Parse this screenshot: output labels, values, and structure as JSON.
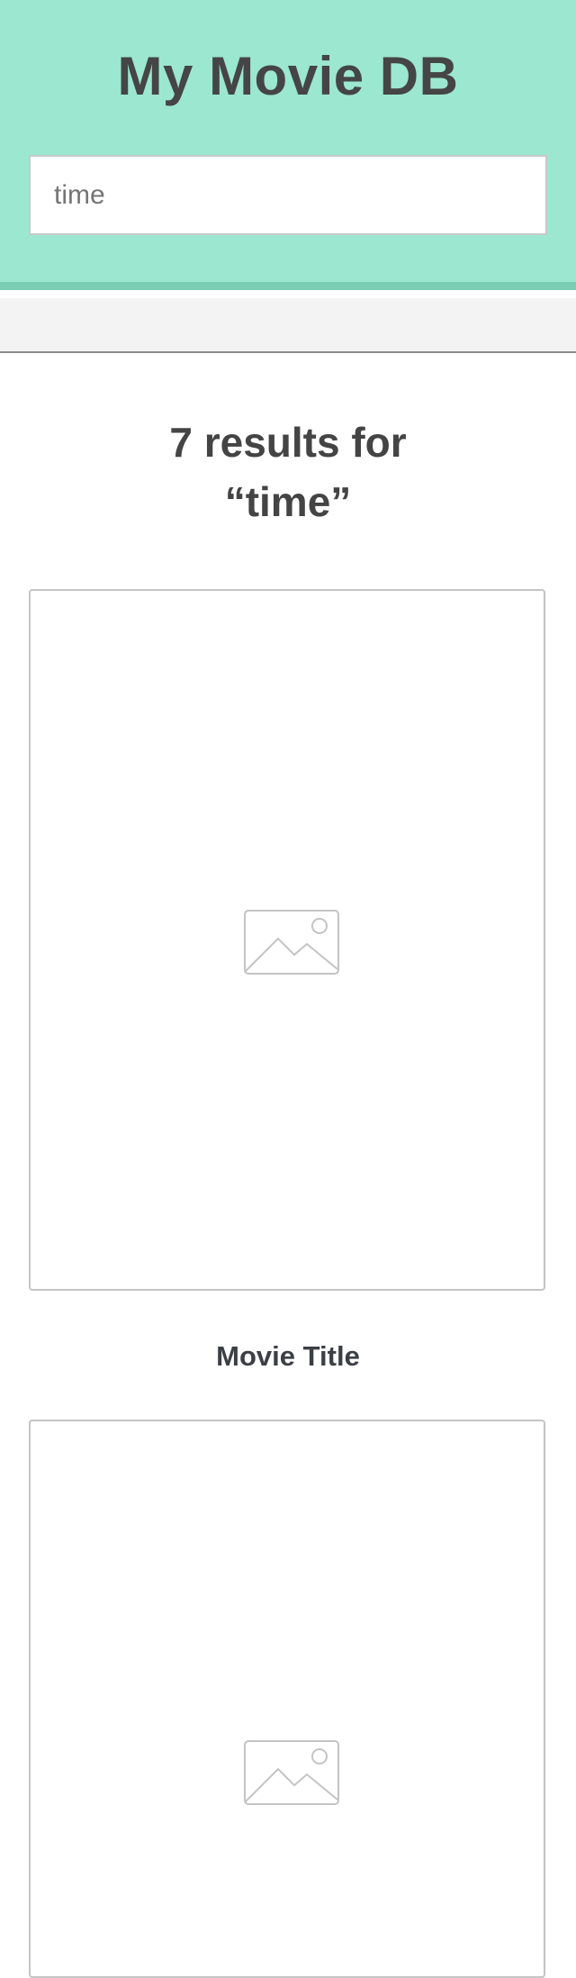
{
  "header": {
    "title": "My Movie DB"
  },
  "search": {
    "value": "",
    "placeholder": "time"
  },
  "results": {
    "count_line": "7 results for",
    "query_line": "“time”"
  },
  "movies": [
    {
      "title": "Movie Title",
      "image_icon": "image-placeholder-icon"
    },
    {
      "title": "",
      "image_icon": "image-placeholder-icon"
    }
  ],
  "colors": {
    "header_bg": "#9be7d0",
    "header_border": "#7acdb3",
    "strip_bg": "#f3f3f3",
    "text_dark": "#444444"
  }
}
